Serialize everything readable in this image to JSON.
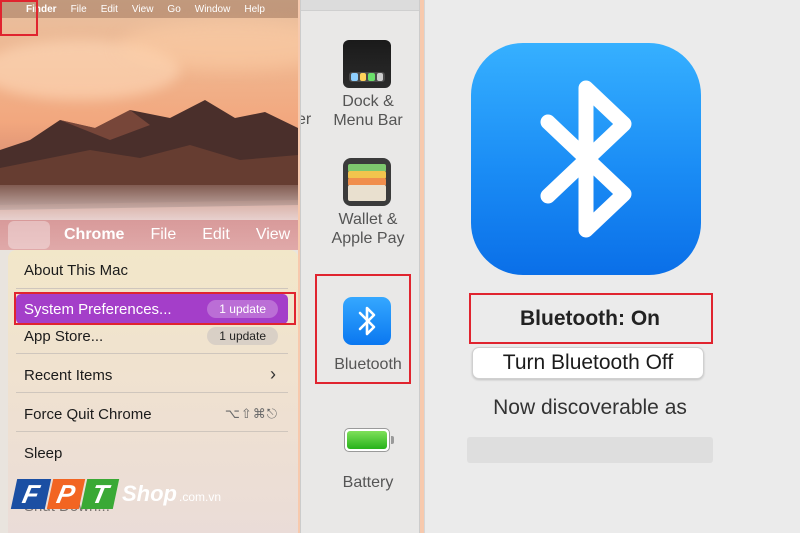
{
  "panel1": {
    "top_menubar": {
      "apple": "",
      "items": [
        "Finder",
        "File",
        "Edit",
        "View",
        "Go",
        "Window",
        "Help"
      ]
    },
    "menubar": {
      "apple": "",
      "app_name": "Chrome",
      "items": [
        "File",
        "Edit",
        "View"
      ]
    },
    "apple_menu": {
      "about": "About This Mac",
      "system_preferences": "System Preferences...",
      "system_preferences_badge": "1 update",
      "app_store": "App Store...",
      "app_store_badge": "1 update",
      "recent_items": "Recent Items",
      "force_quit": "Force Quit Chrome",
      "force_quit_shortcut": "⌥⇧⌘⎋",
      "sleep": "Sleep",
      "shut_down": "Shut Down..."
    },
    "watermark": {
      "letters": [
        "F",
        "P",
        "T"
      ],
      "shop": "Shop",
      "domain": ".com.vn"
    }
  },
  "panel2": {
    "cut_label": "er",
    "prefs": [
      {
        "label_line1": "Dock &",
        "label_line2": "Menu Bar",
        "icon": "dock-menubar-icon"
      },
      {
        "label_line1": "Wallet &",
        "label_line2": "Apple Pay",
        "icon": "wallet-icon"
      },
      {
        "label_line1": "Bluetooth",
        "label_line2": "",
        "icon": "bluetooth-icon"
      },
      {
        "label_line1": "Battery",
        "label_line2": "",
        "icon": "battery-icon"
      }
    ]
  },
  "panel3": {
    "status": "Bluetooth: On",
    "toggle_button": "Turn Bluetooth Off",
    "discoverable_text": "Now discoverable as",
    "device_name": ""
  },
  "colors": {
    "highlight": "#a43ec9",
    "bluetooth_blue": "#1a8cf5",
    "annotation_red": "#e0242f",
    "page_bg": "#f7c9ad"
  }
}
